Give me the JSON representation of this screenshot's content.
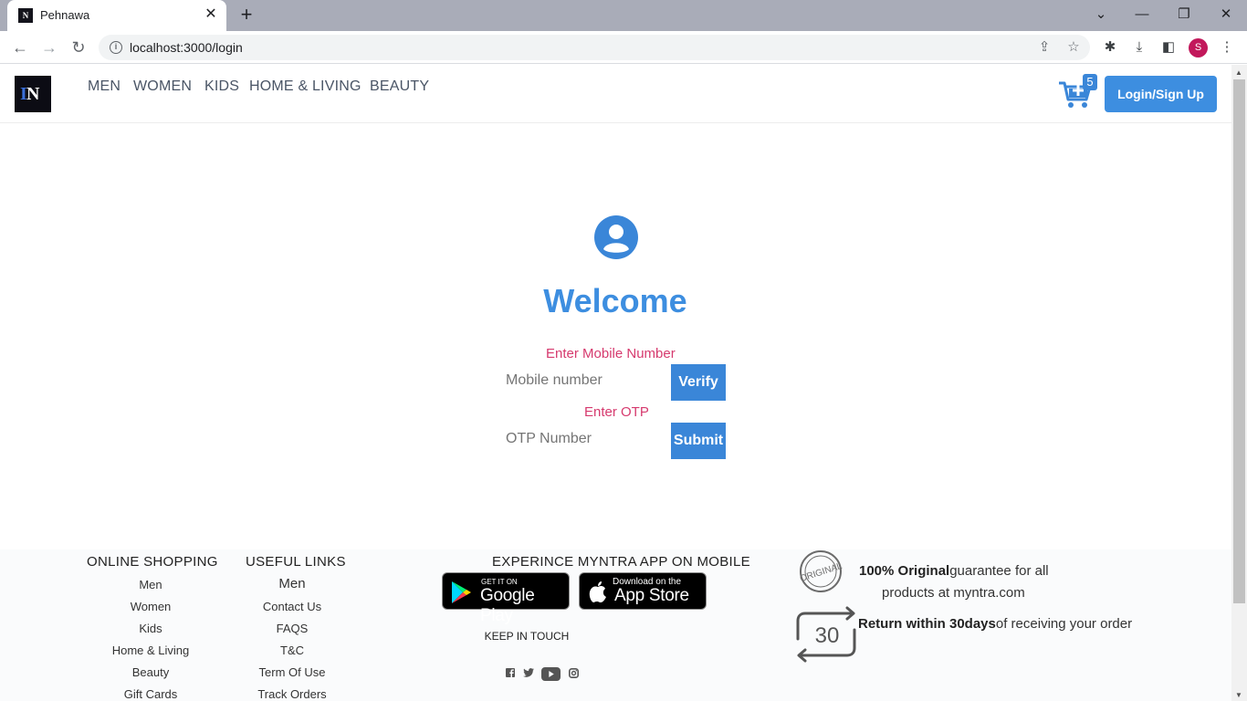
{
  "browser": {
    "tab_title": "Pehnawa",
    "tab_favicon_text": "N",
    "tab_close": "✕",
    "new_tab": "+",
    "url": "localhost:3000/login",
    "profile_initial": "S"
  },
  "header": {
    "nav": [
      "MEN",
      "WOMEN",
      "KIDS",
      "HOME & LIVING",
      "BEAUTY"
    ],
    "cart_count": "5",
    "login_label": "Login/Sign Up"
  },
  "login": {
    "welcome": "Welcome",
    "mobile_label": "Enter Mobile Number",
    "mobile_placeholder": "Mobile number",
    "verify_label": "Verify",
    "otp_label": "Enter OTP",
    "otp_placeholder": "OTP Number",
    "submit_label": "Submit"
  },
  "footer": {
    "online_shopping": {
      "title": "ONLINE SHOPPING",
      "links": [
        "Men",
        "Women",
        "Kids",
        "Home & Living",
        "Beauty",
        "Gift Cards"
      ]
    },
    "useful_links": {
      "title": "USEFUL LINKS",
      "links": [
        "Men",
        "Contact Us",
        "FAQS",
        "T&C",
        "Term Of Use",
        "Track Orders"
      ]
    },
    "app": {
      "title": "EXPERINCE MYNTRA APP ON MOBILE",
      "google_small": "GET IT ON",
      "google_big": "Google Play",
      "apple_small": "Download on the",
      "apple_big": "App Store"
    },
    "keep_in_touch": "KEEP IN TOUCH",
    "promo": {
      "original_bold": "100% Original",
      "original_rest": "guarantee for all",
      "original_line2": "products at myntra.com",
      "original_stamp": "ORIGINAL",
      "return_bold": "Return within 30days",
      "return_rest": "of receiving your order",
      "return_number": "30"
    }
  },
  "colors": {
    "accent": "#3d8ee0",
    "label_pink": "#d63a6e",
    "tabstrip": "#a9acb8"
  }
}
